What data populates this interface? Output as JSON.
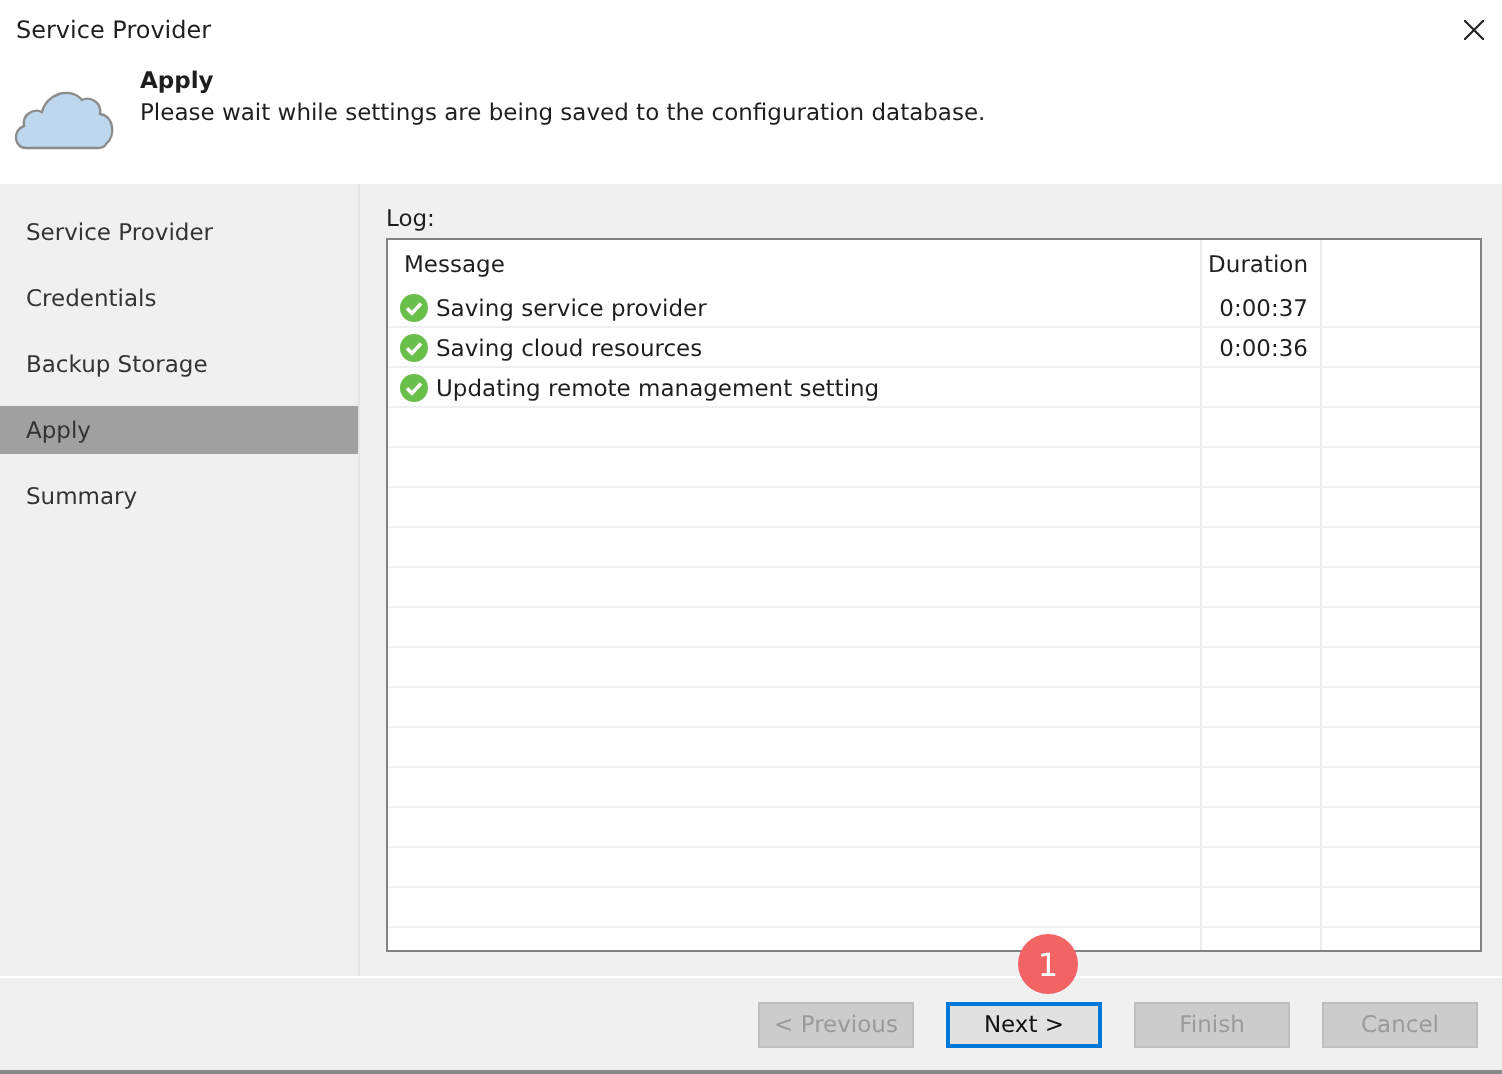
{
  "window": {
    "title": "Service Provider"
  },
  "header": {
    "title": "Apply",
    "description": "Please wait while settings are being saved to the configuration database."
  },
  "sidebar": {
    "items": [
      {
        "label": "Service Provider",
        "selected": false
      },
      {
        "label": "Credentials",
        "selected": false
      },
      {
        "label": "Backup Storage",
        "selected": false
      },
      {
        "label": "Apply",
        "selected": true
      },
      {
        "label": "Summary",
        "selected": false
      }
    ]
  },
  "log": {
    "label": "Log:",
    "columns": [
      "Message",
      "Duration"
    ],
    "rows": [
      {
        "kind": "success",
        "message": "Saving service provider",
        "duration": "0:00:37"
      },
      {
        "kind": "success",
        "message": "Saving cloud resources",
        "duration": "0:00:36"
      },
      {
        "kind": "success",
        "message": "Updating remote management setting"
      }
    ]
  },
  "callout": {
    "label": "1"
  },
  "buttons": [
    {
      "label": "< Previous",
      "disabled": true,
      "focused": false
    },
    {
      "label": "Next >",
      "disabled": false,
      "focused": true
    },
    {
      "label": "Finish",
      "disabled": true,
      "focused": false
    },
    {
      "label": "Cancel",
      "disabled": true,
      "focused": false
    }
  ]
}
